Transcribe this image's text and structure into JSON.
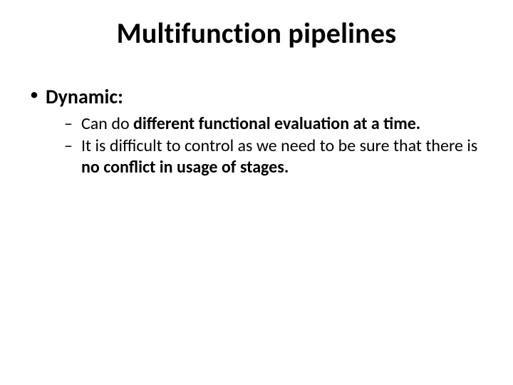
{
  "title": "Multifunction pipelines",
  "bullets": {
    "l1_0": "Dynamic:",
    "l2_0_pre": "Can do ",
    "l2_0_bold": "different functional evaluation at a time.",
    "l2_1_pre": "It is difficult to control as we need to be sure that there is ",
    "l2_1_bold": "no conflict in usage of stages."
  }
}
